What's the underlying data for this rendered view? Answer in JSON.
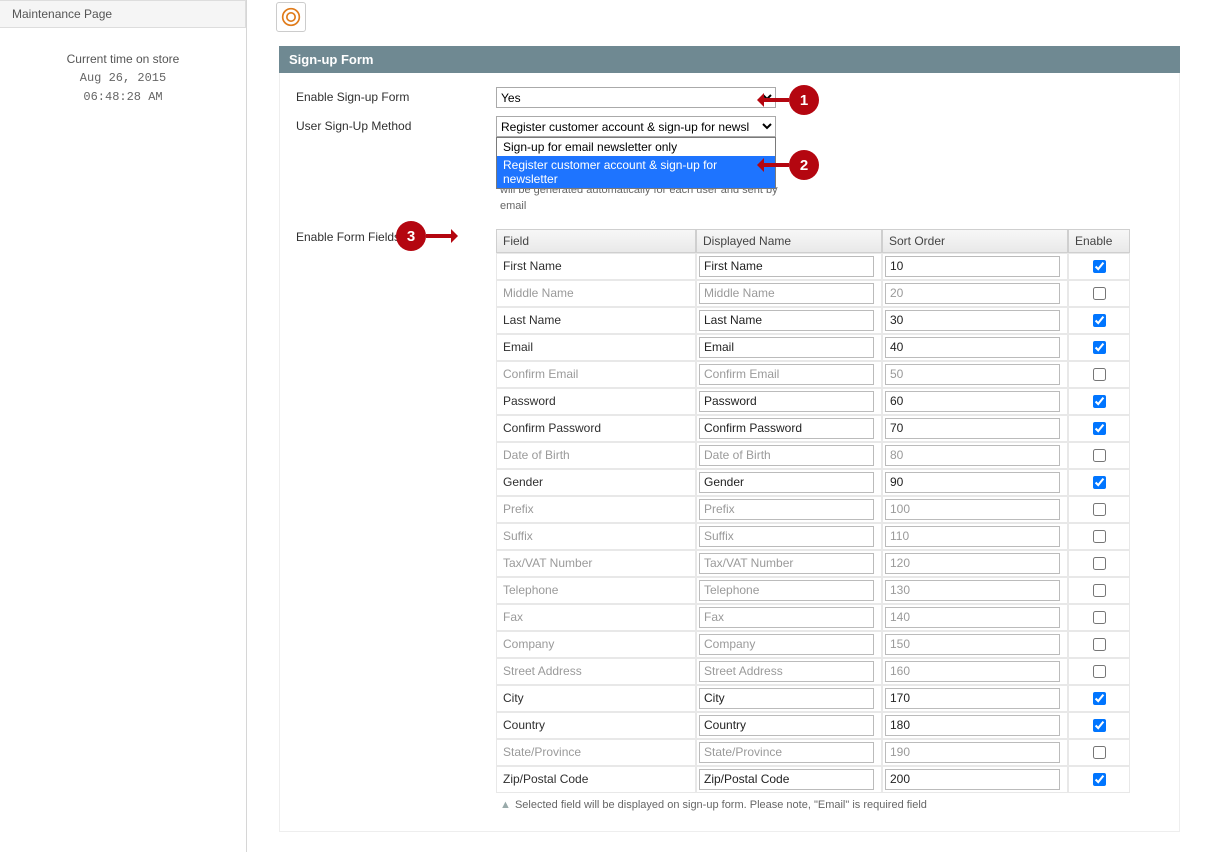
{
  "sidebar": {
    "menu_item": "Maintenance Page",
    "time_label": "Current time on store",
    "date": "Aug 26, 2015",
    "time": "06:48:28 AM"
  },
  "section": {
    "title": "Sign-up Form"
  },
  "form": {
    "enable_label": "Enable Sign-up Form",
    "enable_value": "Yes",
    "method_label": "User Sign-Up Method",
    "method_value": "Register customer account & sign-up for newsl",
    "method_options": {
      "opt1": "Sign-up for email newsletter only",
      "opt2": "Register customer account & sign-up for newsletter"
    },
    "method_hint": "will be generated automatically for each user and sent by email",
    "fields_label": "Enable Form Fields",
    "table": {
      "head_field": "Field",
      "head_dname": "Displayed Name",
      "head_sort": "Sort Order",
      "head_enable": "Enable"
    }
  },
  "fields": [
    {
      "name": "First Name",
      "dname": "First Name",
      "sort": "10",
      "enabled": true
    },
    {
      "name": "Middle Name",
      "dname": "Middle Name",
      "sort": "20",
      "enabled": false
    },
    {
      "name": "Last Name",
      "dname": "Last Name",
      "sort": "30",
      "enabled": true
    },
    {
      "name": "Email",
      "dname": "Email",
      "sort": "40",
      "enabled": true
    },
    {
      "name": "Confirm Email",
      "dname": "Confirm Email",
      "sort": "50",
      "enabled": false
    },
    {
      "name": "Password",
      "dname": "Password",
      "sort": "60",
      "enabled": true
    },
    {
      "name": "Confirm Password",
      "dname": "Confirm Password",
      "sort": "70",
      "enabled": true
    },
    {
      "name": "Date of Birth",
      "dname": "Date of Birth",
      "sort": "80",
      "enabled": false
    },
    {
      "name": "Gender",
      "dname": "Gender",
      "sort": "90",
      "enabled": true
    },
    {
      "name": "Prefix",
      "dname": "Prefix",
      "sort": "100",
      "enabled": false
    },
    {
      "name": "Suffix",
      "dname": "Suffix",
      "sort": "110",
      "enabled": false
    },
    {
      "name": "Tax/VAT Number",
      "dname": "Tax/VAT Number",
      "sort": "120",
      "enabled": false
    },
    {
      "name": "Telephone",
      "dname": "Telephone",
      "sort": "130",
      "enabled": false
    },
    {
      "name": "Fax",
      "dname": "Fax",
      "sort": "140",
      "enabled": false
    },
    {
      "name": "Company",
      "dname": "Company",
      "sort": "150",
      "enabled": false
    },
    {
      "name": "Street Address",
      "dname": "Street Address",
      "sort": "160",
      "enabled": false
    },
    {
      "name": "City",
      "dname": "City",
      "sort": "170",
      "enabled": true
    },
    {
      "name": "Country",
      "dname": "Country",
      "sort": "180",
      "enabled": true
    },
    {
      "name": "State/Province",
      "dname": "State/Province",
      "sort": "190",
      "enabled": false
    },
    {
      "name": "Zip/Postal Code",
      "dname": "Zip/Postal Code",
      "sort": "200",
      "enabled": true
    }
  ],
  "footnote": "Selected field will be displayed on sign-up form. Please note, \"Email\" is required field",
  "annotations": {
    "a1": "1",
    "a2": "2",
    "a3": "3"
  }
}
